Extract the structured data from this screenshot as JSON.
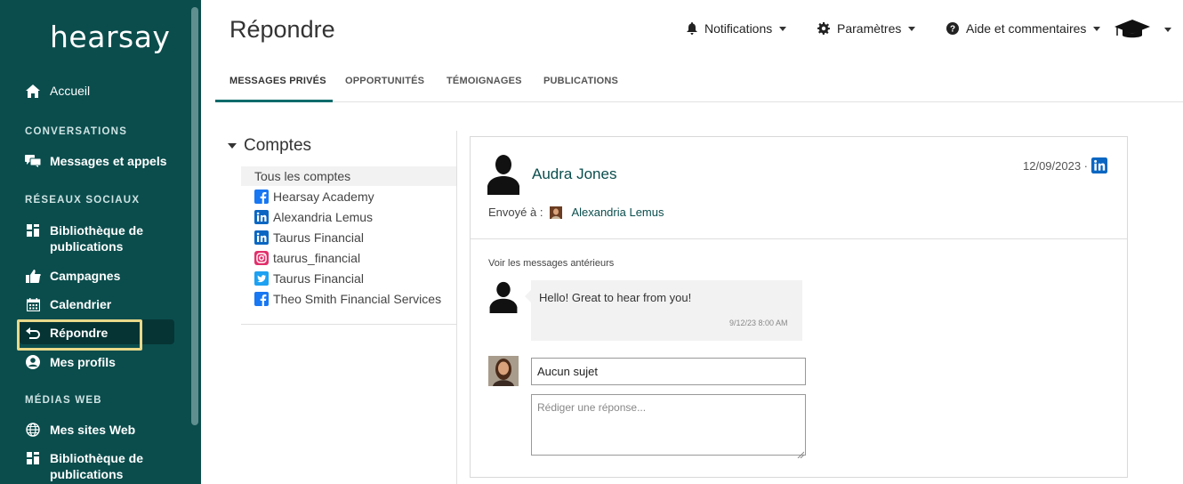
{
  "sidebar": {
    "logo": "hearsay",
    "home": "Accueil",
    "section_conversations": "CONVERSATIONS",
    "messages_calls": "Messages et appels",
    "section_social": "RÉSEAUX SOCIAUX",
    "library_line1": "Bibliothèque de",
    "library_line2": "publications",
    "campaigns": "Campagnes",
    "calendar": "Calendrier",
    "reply": "Répondre",
    "profiles": "Mes profils",
    "section_web": "MÉDIAS WEB",
    "websites": "Mes sites Web",
    "web_library_line1": "Bibliothèque de",
    "web_library_line2": "publications"
  },
  "header": {
    "title": "Répondre",
    "notifications": "Notifications",
    "settings": "Paramètres",
    "help": "Aide et commentaires"
  },
  "tabs": [
    "MESSAGES PRIVÉS",
    "OPPORTUNITÉS",
    "TÉMOIGNAGES",
    "PUBLICATIONS"
  ],
  "accounts": {
    "title": "Comptes",
    "all": "Tous les comptes",
    "items": [
      {
        "network": "facebook",
        "name": "Hearsay Academy"
      },
      {
        "network": "linkedin",
        "name": "Alexandria Lemus"
      },
      {
        "network": "linkedin",
        "name": "Taurus Financial"
      },
      {
        "network": "instagram",
        "name": "taurus_financial"
      },
      {
        "network": "twitter",
        "name": "Taurus Financial"
      },
      {
        "network": "facebook",
        "name": "Theo Smith Financial Services"
      }
    ]
  },
  "message": {
    "sender": "Audra Jones",
    "date": "12/09/2023 ·",
    "sent_to_label": "Envoyé à :",
    "sent_to_name": "Alexandria Lemus",
    "previous_link": "Voir les messages antérieurs",
    "text": "Hello! Great to hear from you!",
    "time": "9/12/23 8:00 AM"
  },
  "composer": {
    "subject_value": "Aucun sujet",
    "reply_placeholder": "Rédiger une réponse..."
  },
  "colors": {
    "sidebar": "#0b4d4d",
    "accent": "#0b6b6b",
    "highlight": "#e9d98a",
    "linkedin": "#0a66c2",
    "facebook": "#1877f2"
  }
}
